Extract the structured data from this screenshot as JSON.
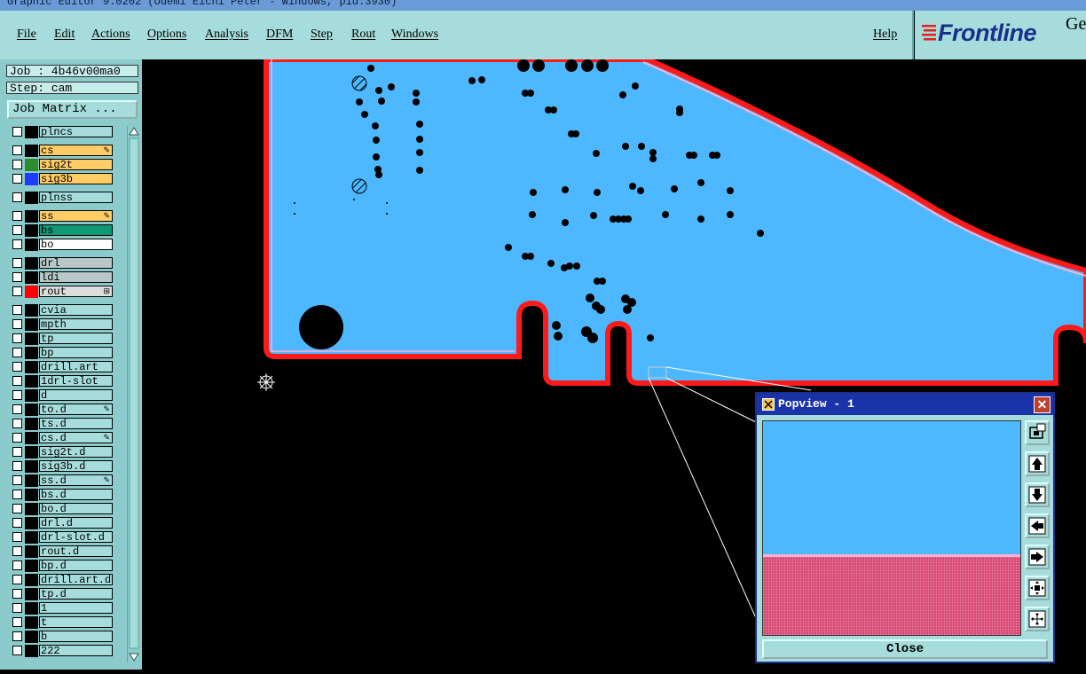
{
  "window": {
    "title": "Graphic Editor 9.0202 (Odemi Eichi Peter - Windows, pid:3930)"
  },
  "menu": {
    "file": "File",
    "edit": "Edit",
    "actions": "Actions",
    "options": "Options",
    "analysis": "Analysis",
    "dfm": "DFM",
    "step": "Step",
    "rout": "Rout",
    "windows": "Windows",
    "help": "Help"
  },
  "brand": {
    "logo": "Frontline",
    "suffix": "Ge"
  },
  "job": {
    "job_label": "Job : 4b46v00ma0",
    "step_label": "Step: cam",
    "matrix_button": "Job Matrix ..."
  },
  "layers": [
    {
      "name": "plncs",
      "bg": "#a6dcdc",
      "color": "#000000",
      "flag": ""
    },
    {
      "name": "cs",
      "bg": "#ffcc66",
      "color": "#000000",
      "flag": "✎"
    },
    {
      "name": "sig2t",
      "bg": "#ffcc66",
      "color": "#2e8b2e",
      "flag": ""
    },
    {
      "name": "sig3b",
      "bg": "#ffcc66",
      "color": "#1e3cff",
      "flag": ""
    },
    {
      "name": "plnss",
      "bg": "#a6dcdc",
      "color": "#000000",
      "flag": ""
    },
    {
      "name": "ss",
      "bg": "#ffcc66",
      "color": "#000000",
      "flag": "✎"
    },
    {
      "name": "bs",
      "bg": "#119977",
      "color": "#000000",
      "flag": ""
    },
    {
      "name": "bo",
      "bg": "#ffffff",
      "color": "#000000",
      "flag": ""
    },
    {
      "name": "drl",
      "bg": "#b8c8c8",
      "color": "#000000",
      "flag": ""
    },
    {
      "name": "ldi",
      "bg": "#b8c8c8",
      "color": "#000000",
      "flag": ""
    },
    {
      "name": "rout",
      "bg": "#dddddd",
      "color": "#ff0000",
      "flag": "⊞"
    },
    {
      "name": "cvia",
      "bg": "#a6dcdc",
      "color": "#000000",
      "flag": ""
    },
    {
      "name": "mpth",
      "bg": "#a6dcdc",
      "color": "#000000",
      "flag": ""
    },
    {
      "name": "tp",
      "bg": "#a6dcdc",
      "color": "#000000",
      "flag": ""
    },
    {
      "name": "bp",
      "bg": "#a6dcdc",
      "color": "#000000",
      "flag": ""
    },
    {
      "name": "drill.art",
      "bg": "#a6dcdc",
      "color": "#000000",
      "flag": ""
    },
    {
      "name": "1drl-slot",
      "bg": "#a6dcdc",
      "color": "#000000",
      "flag": ""
    },
    {
      "name": "d",
      "bg": "#a6dcdc",
      "color": "#000000",
      "flag": ""
    },
    {
      "name": "to.d",
      "bg": "#a6dcdc",
      "color": "#000000",
      "flag": "✎"
    },
    {
      "name": "ts.d",
      "bg": "#a6dcdc",
      "color": "#000000",
      "flag": ""
    },
    {
      "name": "cs.d",
      "bg": "#a6dcdc",
      "color": "#000000",
      "flag": "✎"
    },
    {
      "name": "sig2t.d",
      "bg": "#a6dcdc",
      "color": "#000000",
      "flag": ""
    },
    {
      "name": "sig3b.d",
      "bg": "#a6dcdc",
      "color": "#000000",
      "flag": ""
    },
    {
      "name": "ss.d",
      "bg": "#a6dcdc",
      "color": "#000000",
      "flag": "✎"
    },
    {
      "name": "bs.d",
      "bg": "#a6dcdc",
      "color": "#000000",
      "flag": ""
    },
    {
      "name": "bo.d",
      "bg": "#a6dcdc",
      "color": "#000000",
      "flag": ""
    },
    {
      "name": "drl.d",
      "bg": "#a6dcdc",
      "color": "#000000",
      "flag": ""
    },
    {
      "name": "drl-slot.d",
      "bg": "#a6dcdc",
      "color": "#000000",
      "flag": ""
    },
    {
      "name": "rout.d",
      "bg": "#a6dcdc",
      "color": "#000000",
      "flag": ""
    },
    {
      "name": "bp.d",
      "bg": "#a6dcdc",
      "color": "#000000",
      "flag": ""
    },
    {
      "name": "drill.art.d",
      "bg": "#a6dcdc",
      "color": "#000000",
      "flag": ""
    },
    {
      "name": "tp.d",
      "bg": "#a6dcdc",
      "color": "#000000",
      "flag": ""
    },
    {
      "name": "1",
      "bg": "#a6dcdc",
      "color": "#000000",
      "flag": ""
    },
    {
      "name": "t",
      "bg": "#a6dcdc",
      "color": "#000000",
      "flag": ""
    },
    {
      "name": "b",
      "bg": "#a6dcdc",
      "color": "#000000",
      "flag": ""
    },
    {
      "name": "222",
      "bg": "#a6dcdc",
      "color": "#000000",
      "flag": ""
    }
  ],
  "popview": {
    "title": "Popview - 1",
    "close_label": "Close",
    "close_icon": "✕"
  },
  "colors": {
    "board": "#4db8ff",
    "outline": "#ff1a1a",
    "ui": "#a6dcdc",
    "selection": "#1a33a8",
    "pink": "#d8507a"
  }
}
